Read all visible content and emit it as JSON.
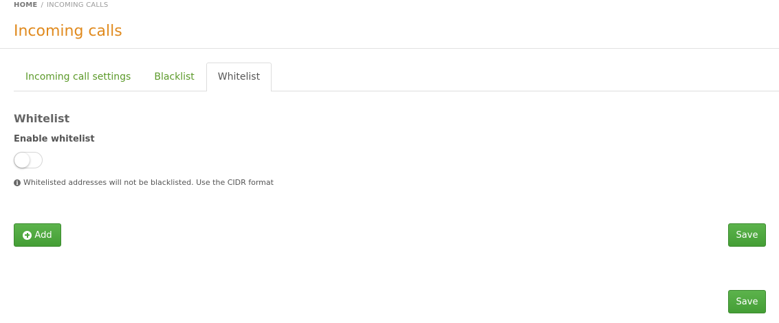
{
  "breadcrumb": {
    "home": "HOME",
    "separator": "/",
    "current": "INCOMING CALLS"
  },
  "page": {
    "title": "Incoming calls"
  },
  "tabs": [
    {
      "label": "Incoming call settings",
      "active": false
    },
    {
      "label": "Blacklist",
      "active": false
    },
    {
      "label": "Whitelist",
      "active": true
    }
  ],
  "section": {
    "title": "Whitelist",
    "enable_label": "Enable whitelist",
    "enabled": false,
    "help_text": "Whitelisted addresses will not be blacklisted. Use the CIDR format",
    "help_icon": "info-circle-icon"
  },
  "actions": {
    "add_label": "Add",
    "add_icon": "plus-circle-icon",
    "save_label": "Save",
    "save_label_bottom": "Save"
  },
  "colors": {
    "title": "#e08a1e",
    "tab_link": "#5c9a2a",
    "button": "#4aa53a"
  }
}
